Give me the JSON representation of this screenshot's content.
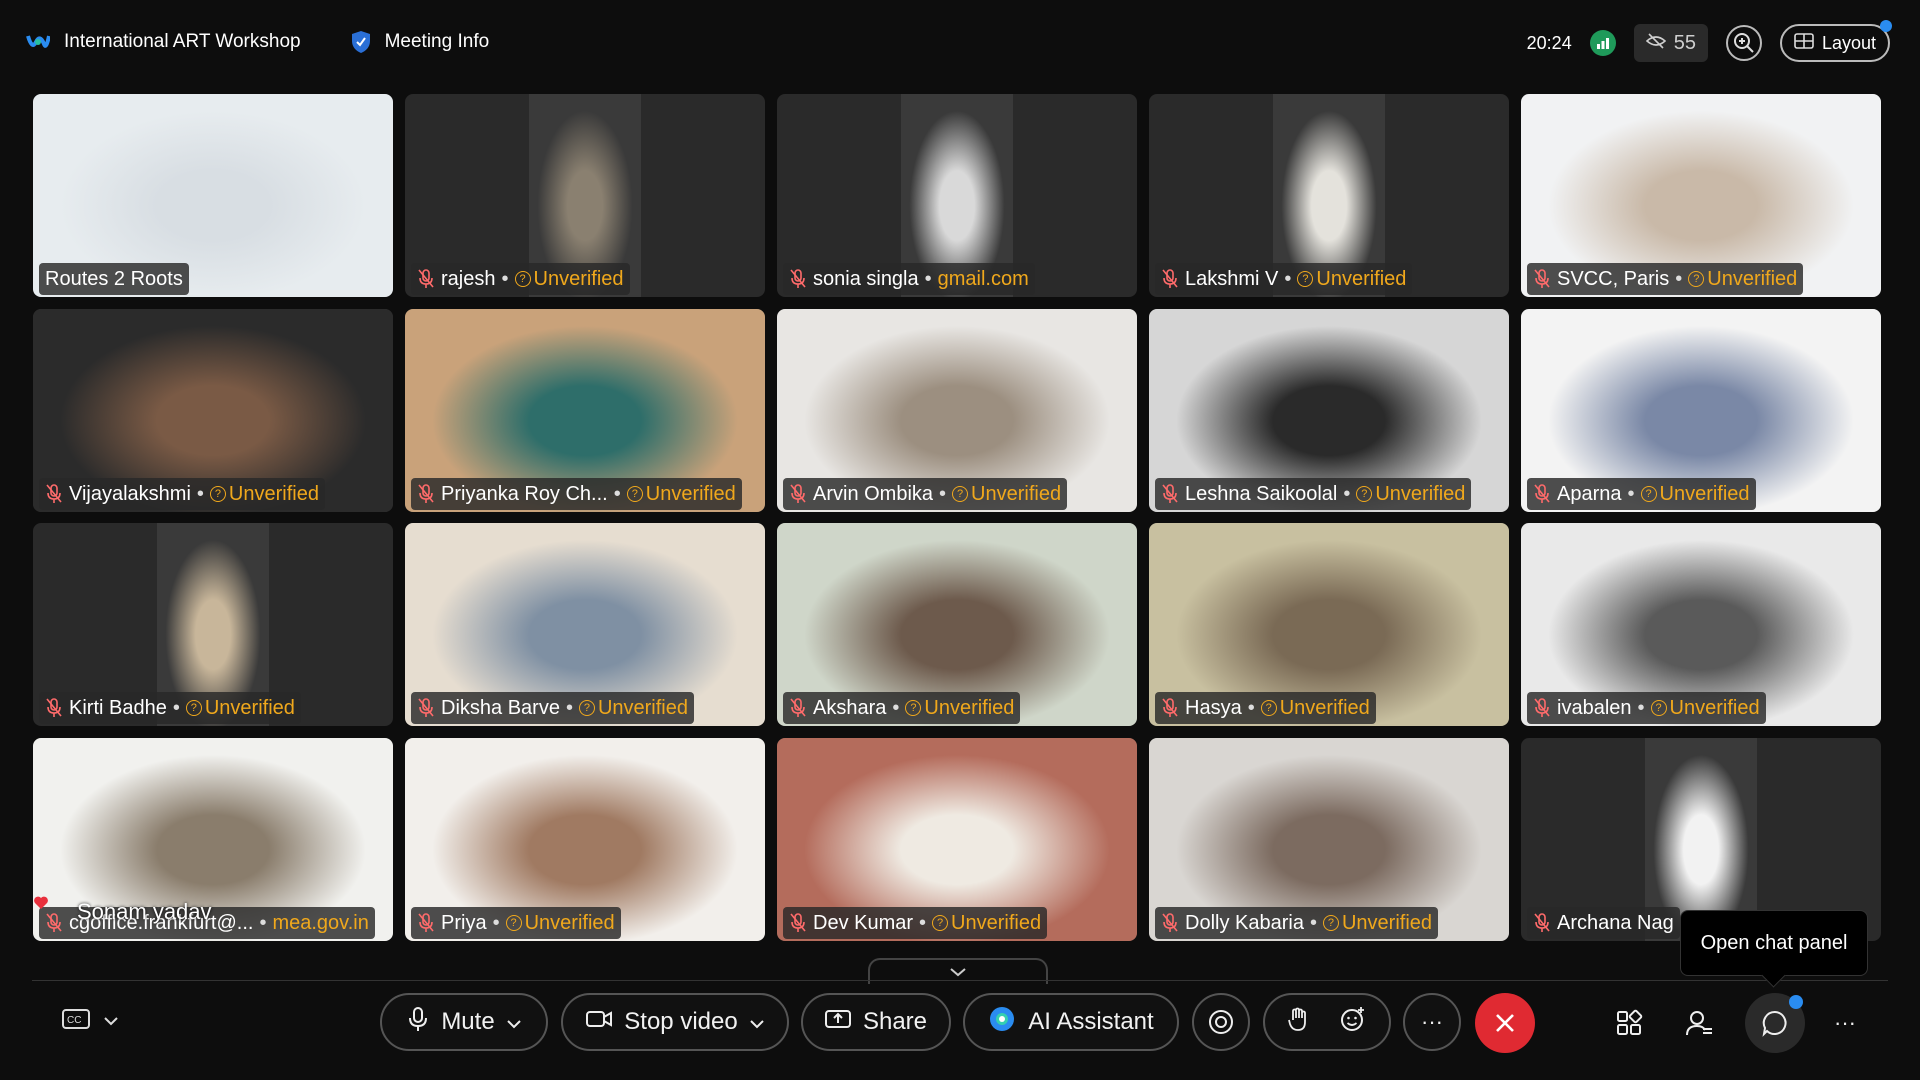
{
  "meeting": {
    "title": "International ART Workshop",
    "info_label": "Meeting Info",
    "time": "20:24",
    "hidden_participants": "55",
    "layout_label": "Layout"
  },
  "tiles": [
    {
      "name": "Routes 2 Roots",
      "status": "",
      "domain": ""
    },
    {
      "name": "rajesh",
      "status": "Unverified",
      "domain": ""
    },
    {
      "name": "sonia singla",
      "status": "",
      "domain": "gmail.com"
    },
    {
      "name": "Lakshmi V",
      "status": "Unverified",
      "domain": ""
    },
    {
      "name": "SVCC, Paris",
      "status": "Unverified",
      "domain": ""
    },
    {
      "name": "Vijayalakshmi",
      "status": "Unverified",
      "domain": ""
    },
    {
      "name": "Priyanka Roy Ch...",
      "status": "Unverified",
      "domain": ""
    },
    {
      "name": "Arvin Ombika",
      "status": "Unverified",
      "domain": ""
    },
    {
      "name": "Leshna Saikoolal",
      "status": "Unverified",
      "domain": ""
    },
    {
      "name": "Aparna",
      "status": "Unverified",
      "domain": ""
    },
    {
      "name": "Kirti Badhe",
      "status": "Unverified",
      "domain": ""
    },
    {
      "name": "Diksha Barve",
      "status": "Unverified",
      "domain": ""
    },
    {
      "name": "Akshara",
      "status": "Unverified",
      "domain": ""
    },
    {
      "name": "Hasya",
      "status": "Unverified",
      "domain": ""
    },
    {
      "name": "ivabalen",
      "status": "Unverified",
      "domain": ""
    },
    {
      "name": "cgoffice.frankfurt@...",
      "status": "",
      "domain": "mea.gov.in",
      "overlay_name": "Sonam yadav"
    },
    {
      "name": "Priya",
      "status": "Unverified",
      "domain": ""
    },
    {
      "name": "Dev Kumar",
      "status": "Unverified",
      "domain": ""
    },
    {
      "name": "Dolly Kabaria",
      "status": "Unverified",
      "domain": ""
    },
    {
      "name": "Archana Nag",
      "status": "",
      "domain": ""
    }
  ],
  "controls": {
    "mute": "Mute",
    "stop_video": "Stop video",
    "share": "Share",
    "ai_assistant": "AI Assistant",
    "more": "···",
    "more_right": "···",
    "chat_tooltip": "Open chat panel"
  },
  "colors": {
    "accent_blue": "#2a8cf0",
    "unverified": "#f0a81c",
    "end_call": "#e02a32",
    "signal": "#1f9a5a"
  }
}
